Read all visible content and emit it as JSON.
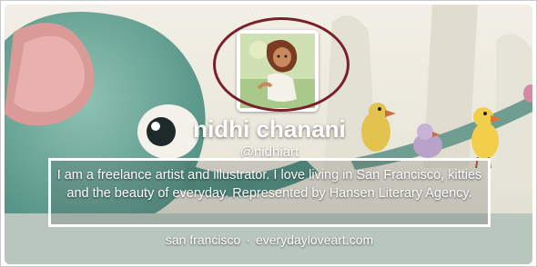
{
  "profile": {
    "name": "nidhi chanani",
    "handle": "@nidhiart",
    "bio": "I am a freelance artist and illustrator. I love living in San Francisco, kitties and the beauty of everyday. Represented by Hansen Literary Agency.",
    "location": "san francisco",
    "separator": "·",
    "url": "everydayloveart.com"
  },
  "colors": {
    "highlight_ellipse": "#7a1e2a",
    "highlight_box": "#ffffff"
  },
  "icons": {
    "avatar": "illustrated-girl-avatar"
  }
}
